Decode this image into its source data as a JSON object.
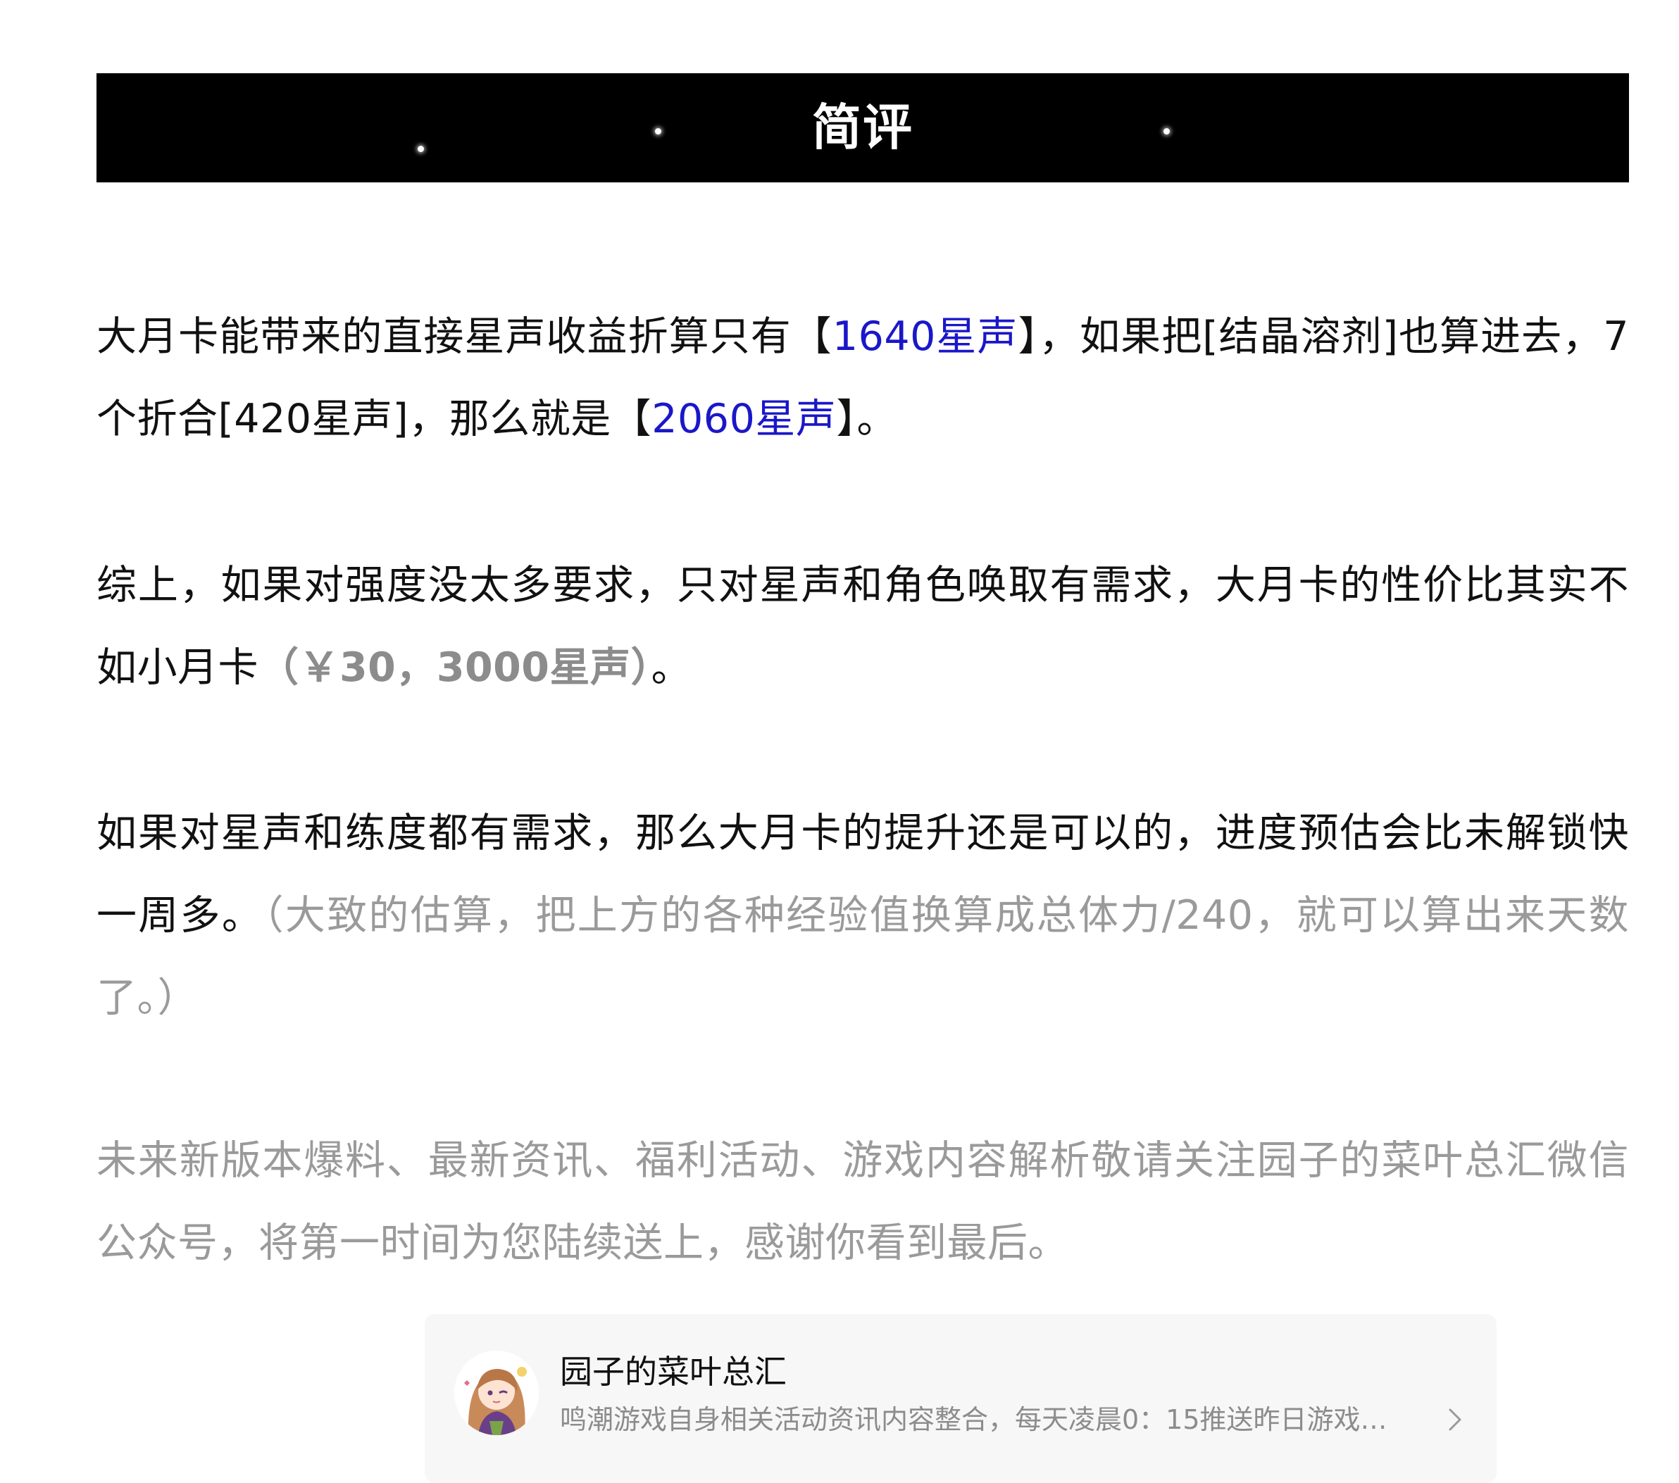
{
  "banner": {
    "title": "简评"
  },
  "paragraphs": {
    "p1": {
      "a": "大月卡能带来的直接星声收益折算只有【",
      "b": "1640星声",
      "c": "】，如果把[结晶溶剂]也算进去，7个折合[420星声]，那么就是【",
      "d": "2060星声",
      "e": "】。"
    },
    "p2": {
      "a": "综上，如果对强度没太多要求，只对星声和角色唤取有需求，大月卡的性价比其实不如小月卡",
      "b": "（￥30，3000星声）",
      "c": "。"
    },
    "p3": {
      "a": "如果对星声和练度都有需求，那么大月卡的提升还是可以的，进度预估会比未解锁快一周多。",
      "b": "（大致的估算，把上方的各种经验值换算成总体力/240，就可以算出来天数了。）"
    },
    "p4": "未来新版本爆料、最新资讯、福利活动、游戏内容解析敬请关注园子的菜叶总汇微信公众号，将第一时间为您陆续送上，感谢你看到最后。"
  },
  "card": {
    "name": "园子的菜叶总汇",
    "description": "鸣潮游戏自身相关活动资讯内容整合，每天凌晨0：15推送昨日游戏动...",
    "avatar_icon": "avatar-anime-girl-icon",
    "chevron_icon": "chevron-right-icon"
  },
  "colors": {
    "banner_bg": "#000000",
    "highlight_blue": "#1a17c9",
    "muted_gray": "#9a9a9a",
    "card_bg": "#f7f7f7"
  }
}
